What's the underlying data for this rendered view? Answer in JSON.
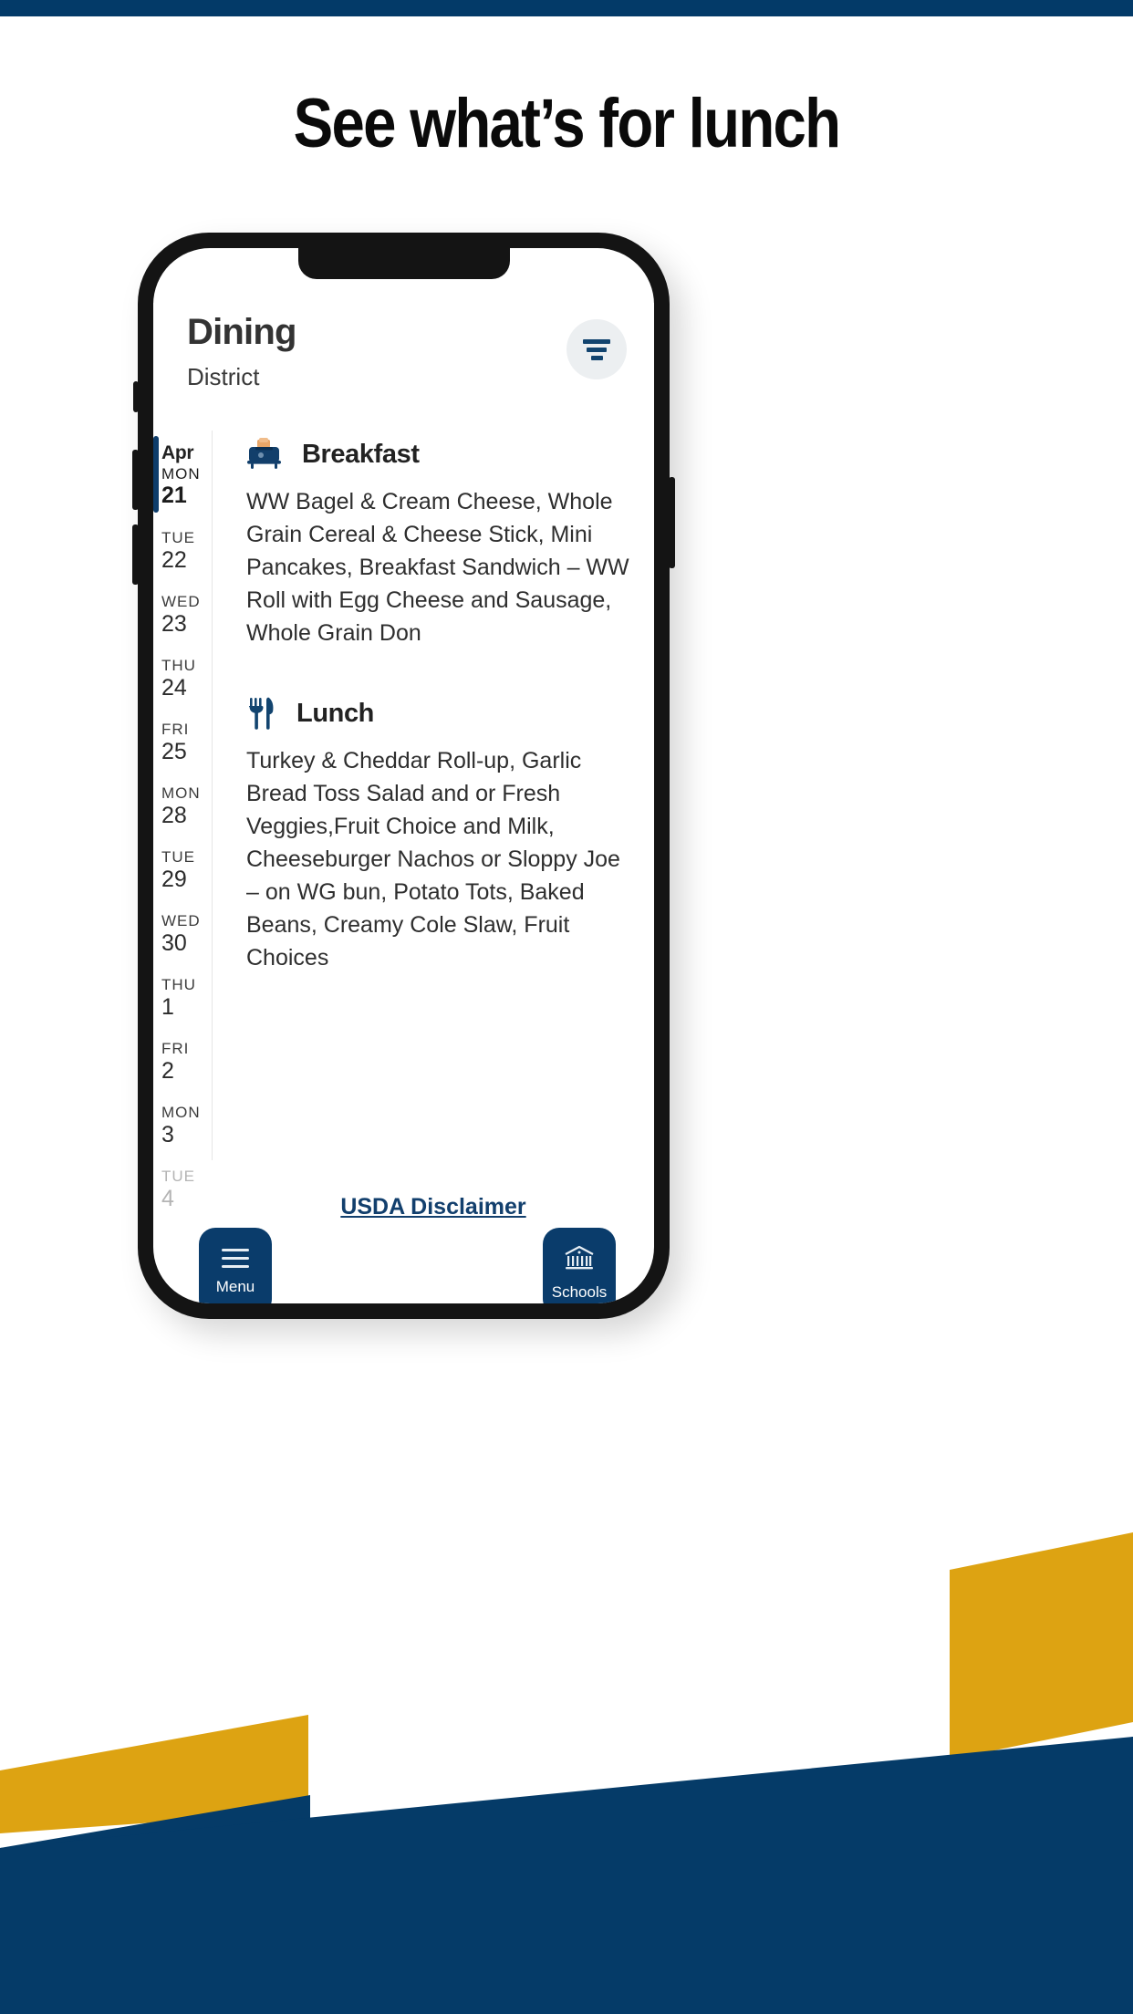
{
  "promo": {
    "headline": "See what’s for lunch",
    "top_bar_color": "#033A68",
    "gold_color": "#DDA312",
    "navy_color": "#053B68"
  },
  "app": {
    "header": {
      "title": "Dining",
      "subtitle": "District",
      "filter_icon": "filter-icon"
    },
    "accent_color": "#0E3D6B",
    "date_rail": {
      "month_label": "Apr",
      "days": [
        {
          "dow": "MON",
          "day": "21",
          "selected": true,
          "faded": false
        },
        {
          "dow": "TUE",
          "day": "22",
          "selected": false,
          "faded": false
        },
        {
          "dow": "WED",
          "day": "23",
          "selected": false,
          "faded": false
        },
        {
          "dow": "THU",
          "day": "24",
          "selected": false,
          "faded": false
        },
        {
          "dow": "FRI",
          "day": "25",
          "selected": false,
          "faded": false
        },
        {
          "dow": "MON",
          "day": "28",
          "selected": false,
          "faded": false
        },
        {
          "dow": "TUE",
          "day": "29",
          "selected": false,
          "faded": false
        },
        {
          "dow": "WED",
          "day": "30",
          "selected": false,
          "faded": false
        },
        {
          "dow": "THU",
          "day": "1",
          "selected": false,
          "faded": false
        },
        {
          "dow": "FRI",
          "day": "2",
          "selected": false,
          "faded": false
        },
        {
          "dow": "MON",
          "day": "3",
          "selected": false,
          "faded": false
        },
        {
          "dow": "TUE",
          "day": "4",
          "selected": false,
          "faded": true
        }
      ]
    },
    "meals": [
      {
        "icon": "toaster-icon",
        "name": "Breakfast",
        "items": "WW Bagel & Cream Cheese, Whole Grain Cereal & Cheese Stick, Mini Pancakes, Breakfast Sandwich – WW Roll with Egg Cheese and Sausage, Whole Grain Don"
      },
      {
        "icon": "fork-knife-icon",
        "name": "Lunch",
        "items": "Turkey & Cheddar Roll-up, Garlic Bread Toss Salad and or Fresh Veggies,Fruit Choice and Milk, Cheeseburger Nachos or Sloppy Joe – on WG bun, Potato Tots, Baked Beans, Creamy Cole Slaw, Fruit Choices"
      }
    ],
    "footer": {
      "usda_link": "USDA Disclaimer",
      "menu_button": {
        "label": "Menu",
        "icon": "hamburger-icon"
      },
      "schools_button": {
        "label": "Schools",
        "icon": "bank-building-icon"
      }
    }
  }
}
